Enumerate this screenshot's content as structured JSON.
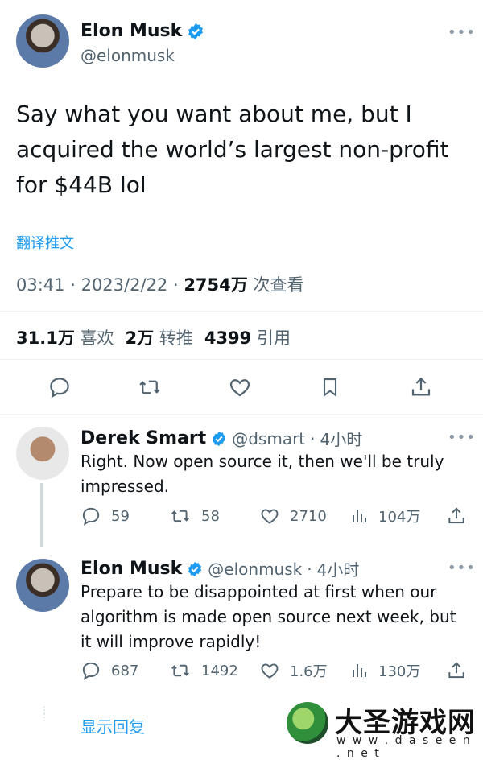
{
  "tweet": {
    "author_name": "Elon Musk",
    "author_handle": "@elonmusk",
    "text": "Say what you want about me, but I acquired the world’s largest non-profit for $44B lol",
    "translate_label": "翻译推文",
    "time": "03:41",
    "date": "2023/2/22",
    "views_count": "2754万",
    "views_label": "次查看",
    "likes_count": "31.1万",
    "likes_label": "喜欢",
    "retweets_count": "2万",
    "retweets_label": "转推",
    "quotes_count": "4399",
    "quotes_label": "引用"
  },
  "replies": [
    {
      "author_name": "Derek Smart",
      "author_handle": "@dsmart",
      "time_ago": "4小时",
      "text": "Right. Now open source it, then we'll be truly impressed.",
      "reply_count": "59",
      "retweet_count": "58",
      "like_count": "2710",
      "view_count": "104万"
    },
    {
      "author_name": "Elon Musk",
      "author_handle": "@elonmusk",
      "time_ago": "4小时",
      "text": "Prepare to be disappointed at first when our algorithm is made open source next week, but it will improve rapidly!",
      "reply_count": "687",
      "retweet_count": "1492",
      "like_count": "1.6万",
      "view_count": "130万"
    }
  ],
  "show_replies_label": "显示回复",
  "watermark": {
    "name": "大圣游戏网",
    "url": "w w w . d a s e e n . n e t"
  },
  "colors": {
    "accent": "#1d9bf0",
    "secondary_text": "#536471",
    "primary_text": "#0f1419"
  },
  "icons": [
    "verified-badge-icon",
    "more-icon",
    "reply-icon",
    "retweet-icon",
    "like-icon",
    "bookmark-icon",
    "share-icon",
    "views-icon"
  ]
}
